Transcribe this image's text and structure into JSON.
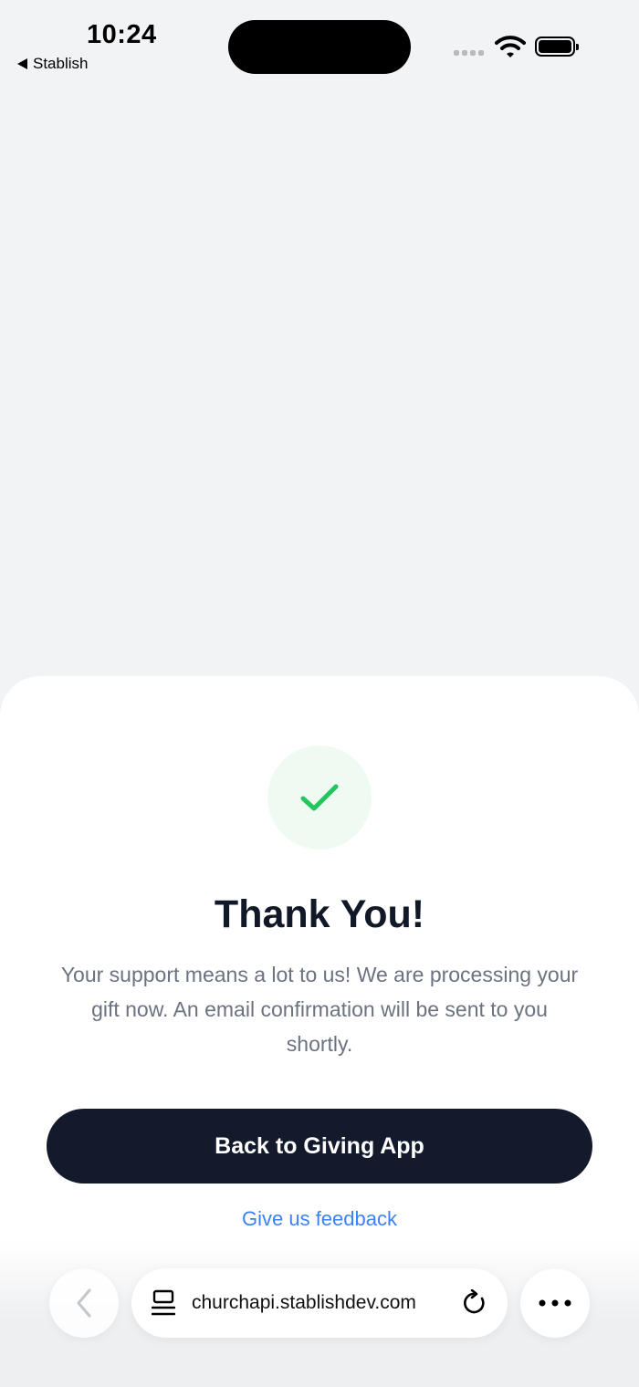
{
  "status_bar": {
    "time": "10:24",
    "back_app": "Stablish"
  },
  "confirmation": {
    "icon": "checkmark-icon",
    "title": "Thank You!",
    "message": "Your support means a lot to us! We are processing your gift now. An email confirmation will be sent to you shortly.",
    "primary_button": "Back to Giving App",
    "feedback_link": "Give us feedback"
  },
  "browser_toolbar": {
    "url": "churchapi.stablishdev.com",
    "icons": [
      "back-arrow-icon",
      "page-menu-icon",
      "reload-icon",
      "more-icon"
    ]
  },
  "colors": {
    "background": "#f2f3f5",
    "sheet": "#ffffff",
    "title": "#111827",
    "body_text": "#6b7280",
    "button": "#131a2b",
    "link": "#3b82f6",
    "success": "#22c55e",
    "success_bg": "#effbf2"
  }
}
